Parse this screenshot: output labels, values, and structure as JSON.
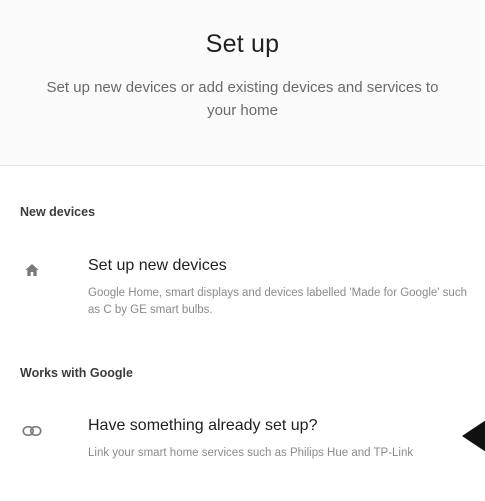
{
  "header": {
    "title": "Set up",
    "subtitle": "Set up new devices or add existing devices and services to your home"
  },
  "sections": {
    "new_devices": {
      "label": "New devices",
      "item": {
        "title": "Set up new devices",
        "description": "Google Home, smart displays and devices labelled 'Made for Google' such as C by GE smart bulbs.",
        "icon": "home-icon"
      }
    },
    "works_with_google": {
      "label": "Works with Google",
      "item": {
        "title": "Have something already set up?",
        "description": "Link your smart home services such as Philips Hue and TP-Link",
        "icon": "link-icon"
      }
    }
  },
  "colors": {
    "icon": "#7a7a7a",
    "header_bg": "#fbfbfb",
    "pointer": "#111111"
  }
}
